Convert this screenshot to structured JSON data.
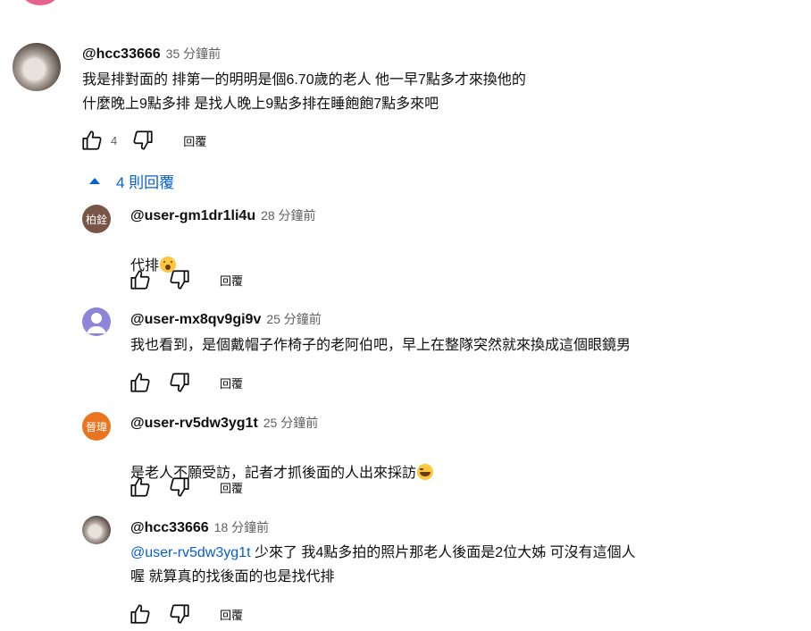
{
  "comment": {
    "author": "@hcc33666",
    "time": "35 分鐘前",
    "text": "我是排對面的 排第一的明明是個6.70歲的老人 他一早7點多才來換他的\n什麼晚上9點多排 是找人晚上9點多排在睡飽飽7點多來吧",
    "likes": "4",
    "reply_label": "回覆",
    "replies_toggle": "4 則回覆"
  },
  "replies": [
    {
      "author": "@user-gm1dr1li4u",
      "time": "28 分鐘前",
      "avatar_text": "柏銓",
      "avatar_color": "#795548",
      "text": "代排",
      "emoji": "astonished-face",
      "reply_label": "回覆"
    },
    {
      "author": "@user-mx8qv9gi9v",
      "time": "25 分鐘前",
      "avatar_color": "#8e84d9",
      "text": "我也看到，是個戴帽子作椅子的老阿伯吧，早上在整隊突然就來換成這個眼鏡男",
      "reply_label": "回覆"
    },
    {
      "author": "@user-rv5dw3yg1t",
      "time": "25 分鐘前",
      "avatar_text": "晉瑋",
      "avatar_color": "#e97520",
      "text": "是老人不願受訪，記者才抓後面的人出來採訪",
      "emoji": "laughing-face",
      "reply_label": "回覆"
    },
    {
      "author": "@hcc33666",
      "time": "18 分鐘前",
      "mention": "@user-rv5dw3yg1t",
      "text": " 少來了 我4點多拍的照片那老人後面是2位大姊 可沒有這個人\n喔 就算真的找後面的也是找代排",
      "reply_label": "回覆"
    }
  ],
  "colors": {
    "accent": "#065fd4",
    "secondary_text": "#606060"
  }
}
